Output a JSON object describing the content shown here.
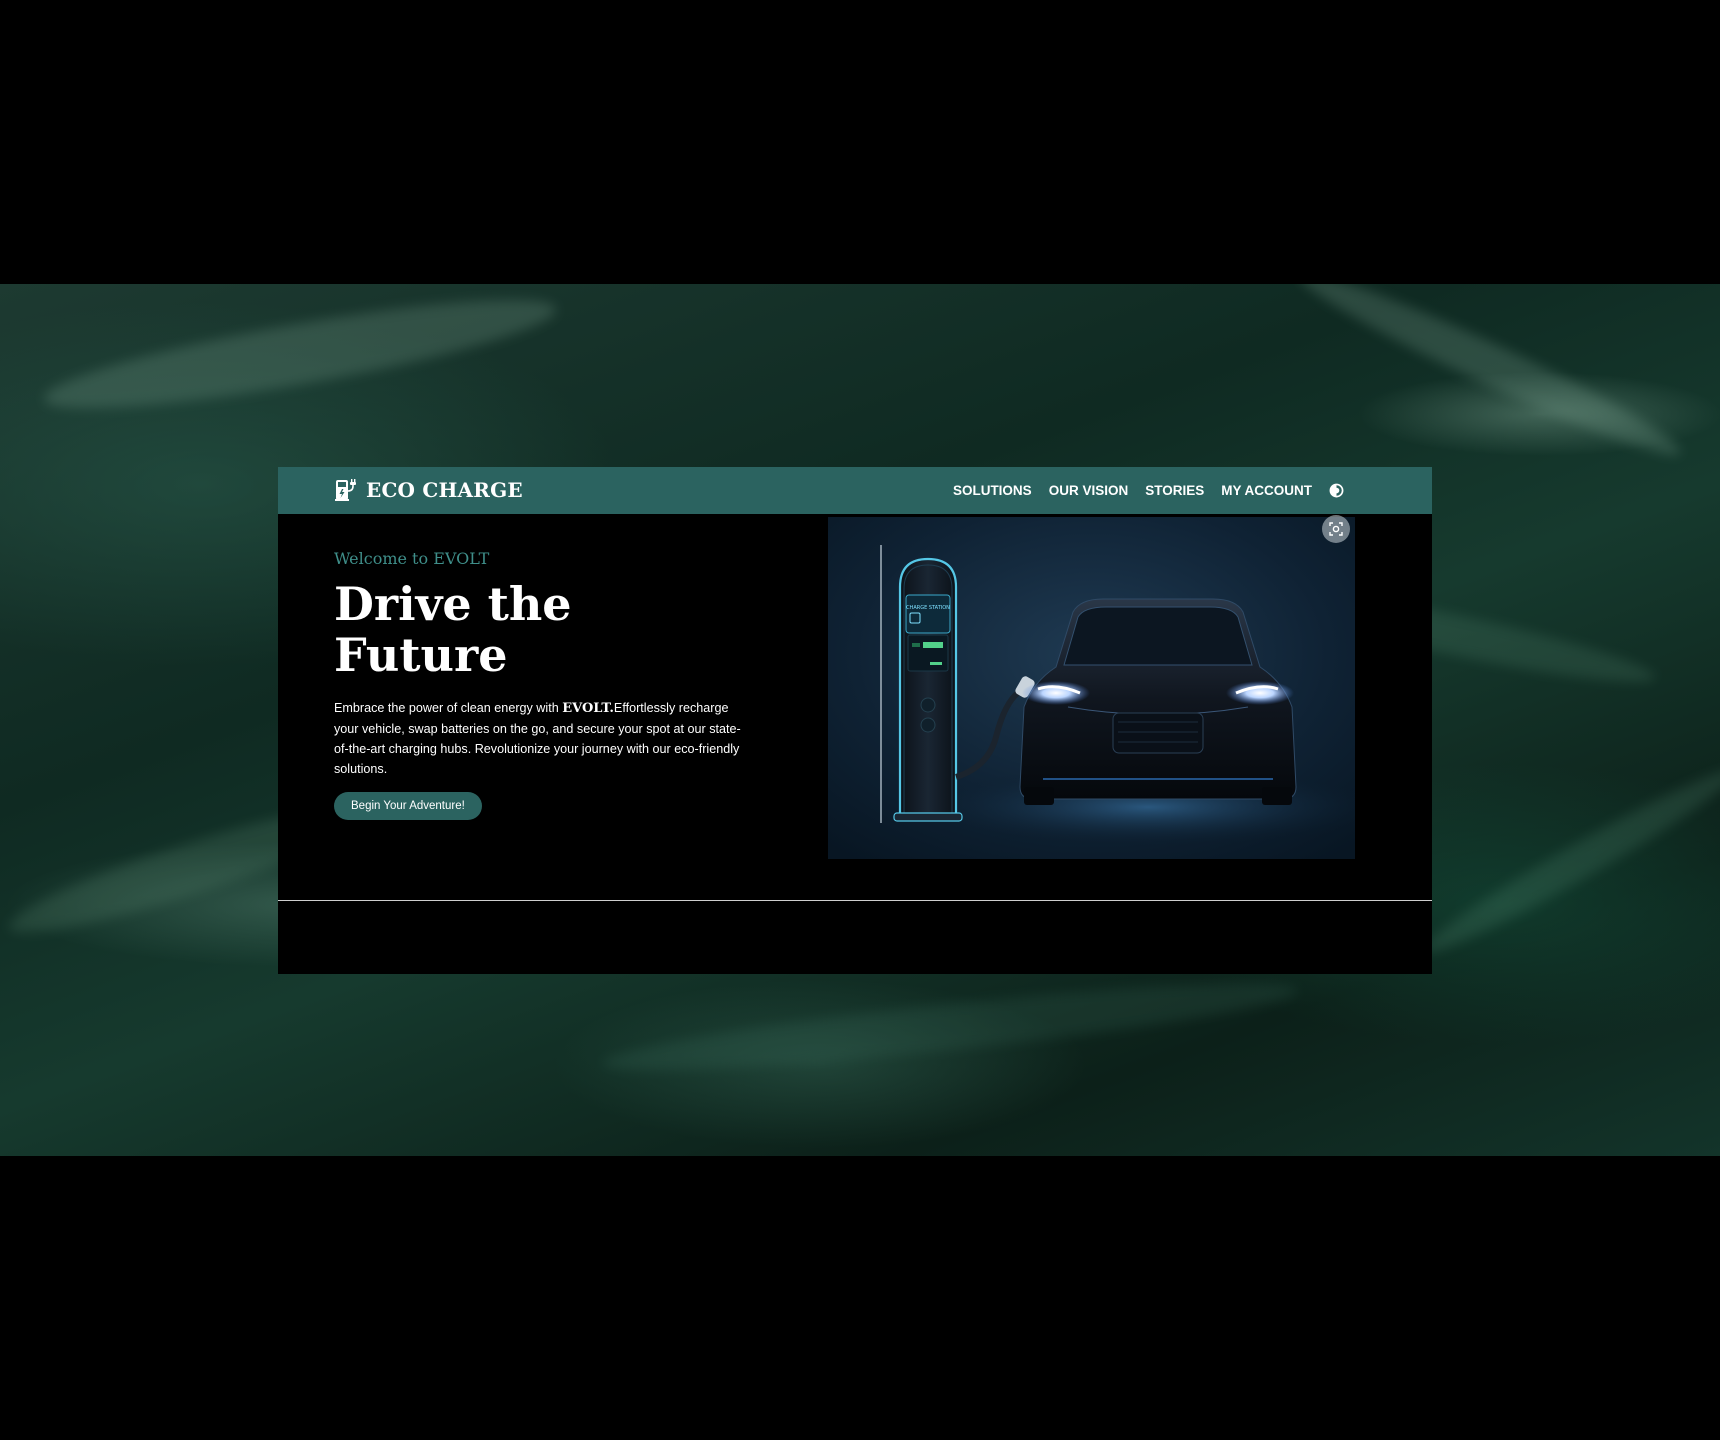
{
  "brand": {
    "name": "ECO CHARGE",
    "logo_icon": "ev-charger-plug-icon"
  },
  "nav": {
    "items": [
      {
        "label": "SOLUTIONS"
      },
      {
        "label": "OUR VISION"
      },
      {
        "label": "STORIES"
      },
      {
        "label": "MY ACCOUNT"
      }
    ],
    "theme_toggle_icon": "contrast-toggle-icon"
  },
  "hero": {
    "eyebrow": "Welcome to EVOLT",
    "title_line1": "Drive the",
    "title_line2": "Future",
    "description_pre": "Embrace the power of clean energy with ",
    "description_brand": "EVOLT.",
    "description_post": "Effortlessly recharge your vehicle, swap batteries on the go, and secure your spot at our state-of-the-art charging hubs. Revolutionize your journey with our eco-friendly solutions.",
    "cta_label": "Begin Your Adventure!",
    "image_station_text": "CHARGE STATION"
  },
  "colors": {
    "navbar": "#2b6360",
    "accent_text": "#3f8f8a",
    "page_background": "#000000"
  }
}
